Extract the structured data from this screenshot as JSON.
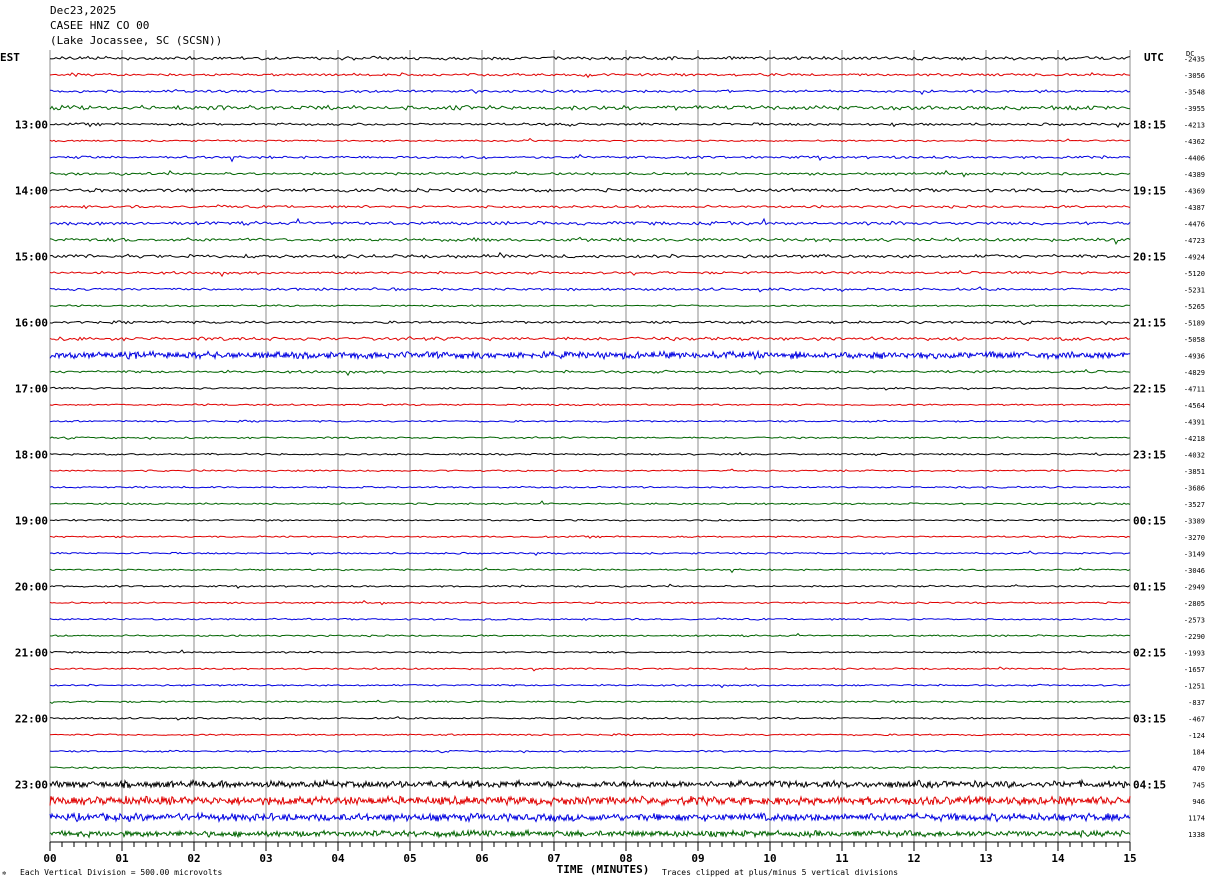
{
  "header": {
    "date": "Dec23,2025",
    "station": "CASEE HNZ CO 00",
    "location": "(Lake Jocassee, SC (SCSN))"
  },
  "chart_data": {
    "type": "line",
    "title": "",
    "left_axis_label": "EST",
    "right_axis_label": "UTC",
    "dc_label": "DC",
    "xlabel": "TIME (MINUTES)",
    "x_ticks": [
      "00",
      "01",
      "02",
      "03",
      "04",
      "05",
      "06",
      "07",
      "08",
      "09",
      "10",
      "11",
      "12",
      "13",
      "14",
      "15"
    ],
    "xlim": [
      0,
      15
    ],
    "row_count": 48,
    "trace_colors": [
      "#000000",
      "#e00000",
      "#0000e0",
      "#006400"
    ],
    "est_hours": [
      {
        "row": 4,
        "label": "13:00"
      },
      {
        "row": 8,
        "label": "14:00"
      },
      {
        "row": 12,
        "label": "15:00"
      },
      {
        "row": 16,
        "label": "16:00"
      },
      {
        "row": 20,
        "label": "17:00"
      },
      {
        "row": 24,
        "label": "18:00"
      },
      {
        "row": 28,
        "label": "19:00"
      },
      {
        "row": 32,
        "label": "20:00"
      },
      {
        "row": 36,
        "label": "21:00"
      },
      {
        "row": 40,
        "label": "22:00"
      },
      {
        "row": 44,
        "label": "23:00"
      }
    ],
    "utc_hours": [
      {
        "row": 4,
        "label": "18:15"
      },
      {
        "row": 8,
        "label": "19:15"
      },
      {
        "row": 12,
        "label": "20:15"
      },
      {
        "row": 16,
        "label": "21:15"
      },
      {
        "row": 20,
        "label": "22:15"
      },
      {
        "row": 24,
        "label": "23:15"
      },
      {
        "row": 28,
        "label": "00:15"
      },
      {
        "row": 32,
        "label": "01:15"
      },
      {
        "row": 36,
        "label": "02:15"
      },
      {
        "row": 40,
        "label": "03:15"
      },
      {
        "row": 44,
        "label": "04:15"
      }
    ],
    "dc_offsets": [
      "-2435",
      "-3056",
      "-3548",
      "-3955",
      "-4213",
      "-4362",
      "-4406",
      "-4389",
      "-4369",
      "-4387",
      "-4476",
      "-4723",
      "-4924",
      "-5120",
      "-5231",
      "-5265",
      "-5189",
      "-5058",
      "-4936",
      "-4829",
      "-4711",
      "-4564",
      "-4391",
      "-4218",
      "-4032",
      "-3851",
      "-3686",
      "-3527",
      "-3389",
      "-3270",
      "-3149",
      "-3046",
      "-2949",
      "-2805",
      "-2573",
      "-2290",
      "-1993",
      "-1657",
      "-1251",
      "-837",
      "-467",
      "-124",
      "184",
      "470",
      "745",
      "946",
      "1174",
      "1338"
    ],
    "amplitude": [
      2,
      1.5,
      1.5,
      2.5,
      1.5,
      1,
      1.5,
      1.5,
      2,
      1.5,
      2,
      2,
      2,
      1.5,
      1.5,
      1,
      1.5,
      2,
      4,
      1.5,
      1,
      1,
      1,
      1,
      1,
      1,
      1,
      1,
      1,
      1,
      1,
      1,
      1,
      1,
      1,
      1,
      1,
      1,
      1,
      1,
      1,
      1,
      1,
      1,
      4,
      5,
      4.5,
      3.5
    ],
    "footer_left": "Each Vertical Division =  500.00 microvolts",
    "footer_right": "Traces clipped at plus/minus 5 vertical divisions"
  }
}
